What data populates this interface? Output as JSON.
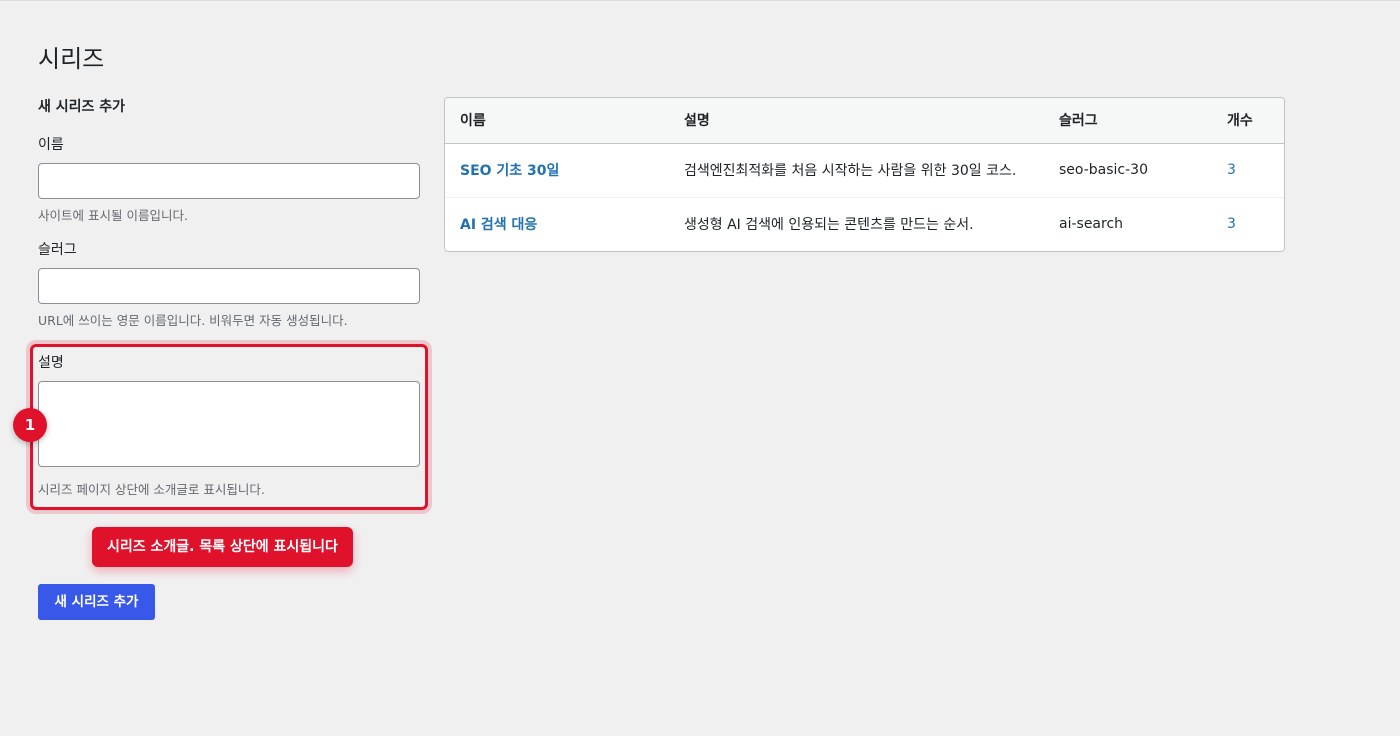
{
  "page": {
    "title": "시리즈"
  },
  "form": {
    "heading": "새 시리즈 추가",
    "name": {
      "label": "이름",
      "value": "",
      "help": "사이트에 표시될 이름입니다."
    },
    "slug": {
      "label": "슬러그",
      "value": "",
      "help": "URL에 쓰이는 영문 이름입니다. 비워두면 자동 생성됩니다."
    },
    "description": {
      "label": "설명",
      "value": "",
      "help": "시리즈 페이지 상단에 소개글로 표시됩니다."
    },
    "submit_label": "새 시리즈 추가"
  },
  "annotation": {
    "step_number": "1",
    "callout": "시리즈 소개글. 목록 상단에 표시됩니다",
    "color": "#e0112b"
  },
  "table": {
    "headers": {
      "name": "이름",
      "description": "설명",
      "slug": "슬러그",
      "count": "개수"
    },
    "rows": [
      {
        "name": "SEO 기초 30일",
        "description": "검색엔진최적화를 처음 시작하는 사람을 위한 30일 코스.",
        "slug": "seo-basic-30",
        "count": "3"
      },
      {
        "name": "AI 검색 대응",
        "description": "생성형 AI 검색에 인용되는 콘텐츠를 만드는 순서.",
        "slug": "ai-search",
        "count": "3"
      }
    ]
  },
  "colors": {
    "link": "#2271b1",
    "button": "#3858e9",
    "background": "#f0f0f1"
  }
}
